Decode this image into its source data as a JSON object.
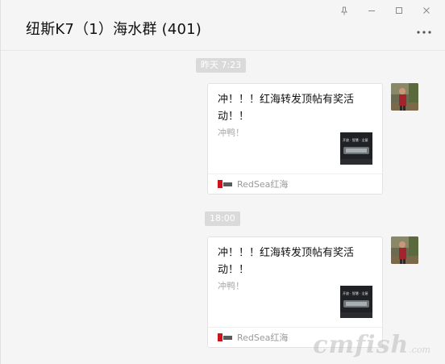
{
  "window": {
    "title": "纽斯K7（1）海水群 (401)"
  },
  "messages": [
    {
      "timestamp": "昨天 7:23",
      "card": {
        "title": "冲！！！红海转发顶帖有奖活动！！",
        "description": "冲鸭！",
        "source_name": "RedSea红海",
        "thumb_text": "开放 · 智慧 · 全屋"
      }
    },
    {
      "timestamp": "18:00",
      "card": {
        "title": "冲！！！红海转发顶帖有奖活动！！",
        "description": "冲鸭！",
        "source_name": "RedSea红海",
        "thumb_text": "开放 · 智慧 · 全屋"
      }
    }
  ],
  "watermark": {
    "text": "cmfish",
    "suffix": ".com"
  },
  "colors": {
    "background": "#f5f5f5",
    "timestamp_bg": "#dadada",
    "card_bg": "#ffffff",
    "source_text": "#9a9a9a",
    "brand_red": "#d0121b"
  }
}
